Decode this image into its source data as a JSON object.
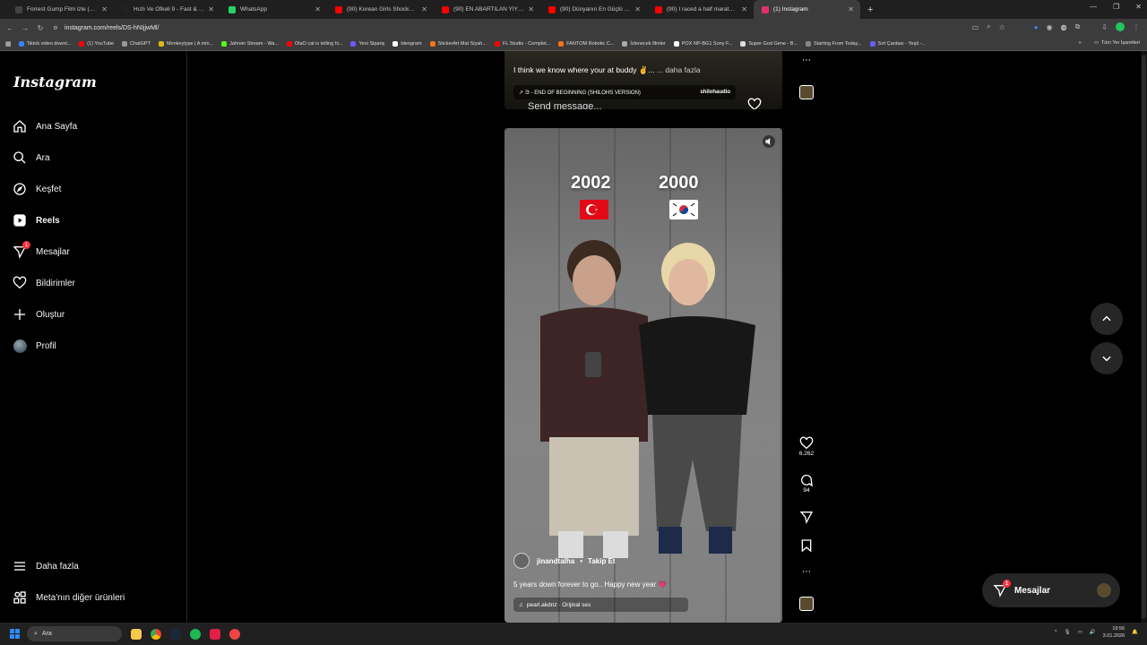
{
  "browser": {
    "tabs": [
      {
        "label": "Forrest Gump Film izle (1994)",
        "color": "#444444"
      },
      {
        "label": "Hızlı Ve Öfkeli 9 - Fast & Furious",
        "color": "#222222"
      },
      {
        "label": "WhatsApp",
        "color": "#25d366"
      },
      {
        "label": "(90) Korean Girls Shocked By N",
        "color": "#ff0000"
      },
      {
        "label": "(90) EN ABARTILAN YİYECEK - Y",
        "color": "#ff0000"
      },
      {
        "label": "(90) Dünyanın En Güçlü Ünivers",
        "color": "#ff0000"
      },
      {
        "label": "(90) I raced a half marathon - Y",
        "color": "#ff0000"
      },
      {
        "label": "(1) Instagram",
        "color": "#e1306c",
        "active": true
      }
    ],
    "new_tab": "+",
    "url": "instagram.com/reels/DS-hNIjjwMl/",
    "bookmarks": [
      {
        "label": "Tiktok video downl...",
        "color": "#3b82f6"
      },
      {
        "label": "(1) YouTube",
        "color": "#ff0000"
      },
      {
        "label": "ChatGPT",
        "color": "#999999"
      },
      {
        "label": "Monkeytype | A min...",
        "color": "#e2b714"
      },
      {
        "label": "Jahrein Stream - Wa...",
        "color": "#53fc18"
      },
      {
        "label": "OlaO cat is telling hi...",
        "color": "#ff0000"
      },
      {
        "label": "Yeni Sipariş",
        "color": "#6b5bff"
      },
      {
        "label": "Ideogram",
        "color": "#ffffff"
      },
      {
        "label": "StickerArt Mat Siyah...",
        "color": "#f97316"
      },
      {
        "label": "FL Studio - Complet...",
        "color": "#ff0000"
      },
      {
        "label": "FANTOM Robotic C...",
        "color": "#f97316"
      },
      {
        "label": "İzlenecek filmler",
        "color": "#aaaaaa"
      },
      {
        "label": "POX NP-BG1 Sony F...",
        "color": "#ffffff"
      },
      {
        "label": "Super God Gene - B...",
        "color": "#dddddd"
      },
      {
        "label": "Starting From Today...",
        "color": "#888888"
      },
      {
        "label": "Sırt Çantası - Yeşil -...",
        "color": "#6b5bff"
      }
    ],
    "bookmarks_more": "»",
    "all_bookmarks": "Tüm Yer İşaretleri"
  },
  "sidebar": {
    "logo": "Instagram",
    "items": [
      {
        "label": "Ana Sayfa",
        "icon": "home-icon"
      },
      {
        "label": "Ara",
        "icon": "search-icon"
      },
      {
        "label": "Keşfet",
        "icon": "compass-icon"
      },
      {
        "label": "Reels",
        "icon": "reels-icon",
        "active": true
      },
      {
        "label": "Mesajlar",
        "icon": "messenger-icon",
        "badge": "1"
      },
      {
        "label": "Bildirimler",
        "icon": "heart-icon"
      },
      {
        "label": "Oluştur",
        "icon": "plus-icon"
      },
      {
        "label": "Profil",
        "icon": "avatar"
      }
    ],
    "more": "Daha fazla",
    "meta": "Meta'nın diğer ürünleri"
  },
  "prev_post": {
    "caption": "I think we know where your at buddy ✌️...",
    "caption_more": "... daha fazla",
    "music": "↗ ∋ - END OF BEGINNING (SHILOHS VERSION)",
    "music_user": "shilohaudio",
    "send_placeholder": "Send message..."
  },
  "reel": {
    "year_left": "2002",
    "year_right": "2000",
    "username": "jinandtalha",
    "follow": "Takip Et",
    "caption": "5 years down forever to go.. Happy new year 💗",
    "audio": "pearl.akdnz · Orijinal ses",
    "likes": "6.262",
    "comments": "94"
  },
  "messages_pill": {
    "label": "Mesajlar",
    "badge": "1"
  },
  "taskbar": {
    "search": "Ara",
    "time": "19:56",
    "date": "3.01.2026"
  },
  "colors": {
    "bg": "#000000",
    "notif": "#ff3040",
    "chrome_tab_bg": "#1f1f1f"
  }
}
